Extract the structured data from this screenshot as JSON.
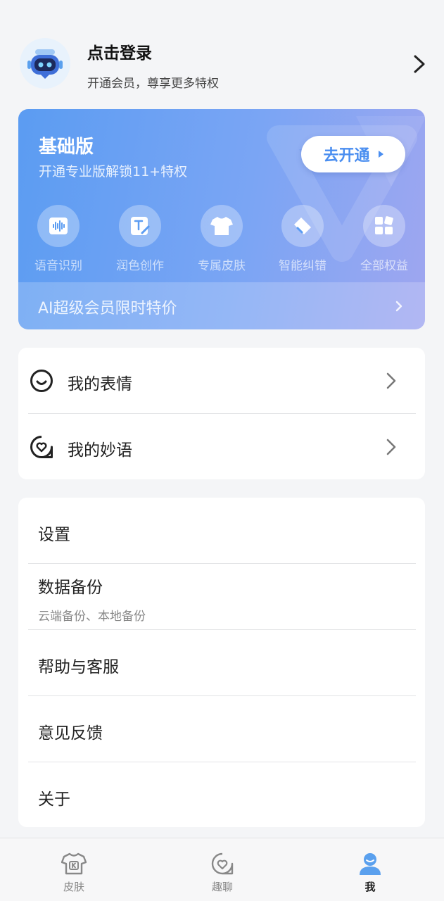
{
  "profile": {
    "title": "点击登录",
    "subtitle": "开通会员，尊享更多特权"
  },
  "vip": {
    "title": "基础版",
    "subtitle": "开通专业版解锁11+特权",
    "button_label": "去开通",
    "features": [
      {
        "label": "语音识别",
        "icon": "voice-wave-icon"
      },
      {
        "label": "润色创作",
        "icon": "text-edit-icon"
      },
      {
        "label": "专属皮肤",
        "icon": "tshirt-icon"
      },
      {
        "label": "智能纠错",
        "icon": "eraser-icon"
      },
      {
        "label": "全部权益",
        "icon": "grid-apps-icon"
      }
    ],
    "promo_label": "AI超级会员限时特价"
  },
  "my_items": [
    {
      "label": "我的表情",
      "icon": "smile-face-icon"
    },
    {
      "label": "我的妙语",
      "icon": "heart-bubble-icon"
    }
  ],
  "settings_items": [
    {
      "label": "设置"
    },
    {
      "label": "数据备份",
      "desc": "云端备份、本地备份"
    },
    {
      "label": "帮助与客服"
    },
    {
      "label": "意见反馈"
    },
    {
      "label": "关于"
    }
  ],
  "nav": {
    "items": [
      {
        "label": "皮肤",
        "icon": "skin-tshirt-icon",
        "active": false
      },
      {
        "label": "趣聊",
        "icon": "chat-heart-icon",
        "active": false
      },
      {
        "label": "我",
        "icon": "user-icon",
        "active": true
      }
    ]
  },
  "colors": {
    "accent": "#4a8ef0",
    "card_gradient_start": "#5b9cf2",
    "card_gradient_end": "#9fa6f0",
    "nav_active": "#5aa0ee"
  }
}
